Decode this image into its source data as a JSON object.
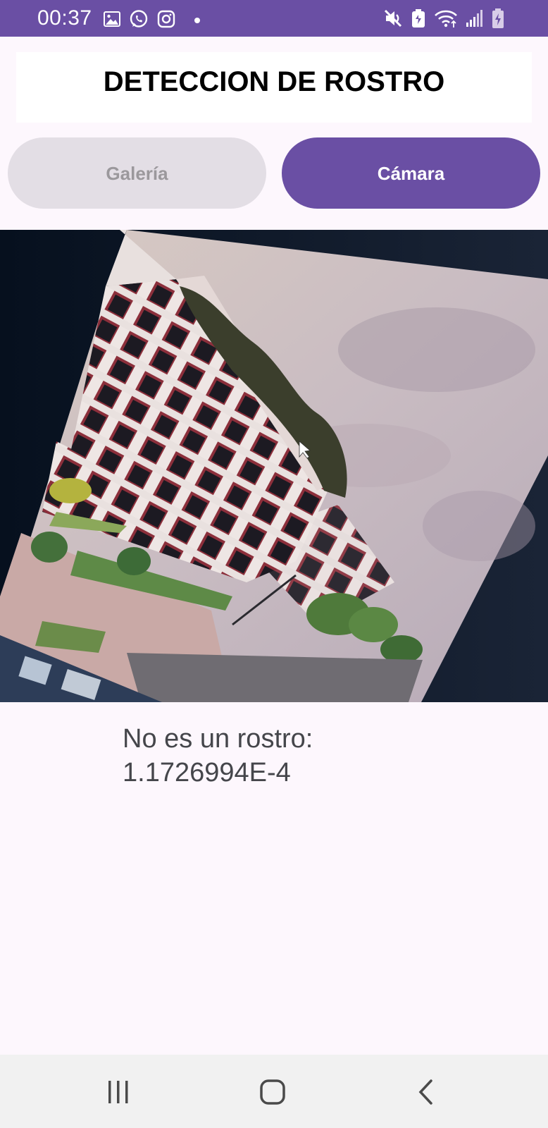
{
  "status_bar": {
    "time": "00:37",
    "left_icons": [
      "gallery-notification-icon",
      "whatsapp-icon",
      "instagram-icon",
      "dot-icon"
    ],
    "right_icons": [
      "mute-icon",
      "battery-saver-icon",
      "wifi-icon",
      "signal-icon",
      "battery-charging-icon"
    ],
    "color": "#6a4fa4"
  },
  "header": {
    "title": "DETECCION DE ROSTRO"
  },
  "buttons": {
    "gallery_label": "Galería",
    "camera_label": "Cámara",
    "accent": "#6a4fa4"
  },
  "result": {
    "line1": "No es un rostro:",
    "line2": "1.1726994E-4"
  },
  "nav_bar": {
    "icons": [
      "recent-apps-icon",
      "home-icon",
      "back-icon"
    ]
  }
}
